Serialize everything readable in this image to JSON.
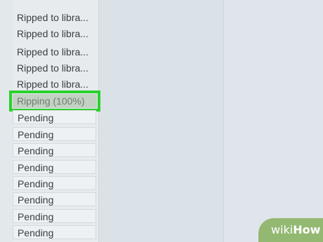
{
  "rip_status": {
    "items": [
      {
        "label": "Ripped to libra...",
        "state": "ripped"
      },
      {
        "label": "Ripped to libra...",
        "state": "ripped"
      },
      {
        "label": "Ripped to libra...",
        "state": "ripped"
      },
      {
        "label": "Ripped to libra...",
        "state": "ripped"
      },
      {
        "label": "Ripped to libra...",
        "state": "ripped"
      },
      {
        "label": "Ripping (100%)",
        "state": "ripping",
        "progress": 1.0
      },
      {
        "label": "Pending",
        "state": "pending"
      },
      {
        "label": "Pending",
        "state": "pending"
      },
      {
        "label": "Pending",
        "state": "pending"
      },
      {
        "label": "Pending",
        "state": "pending"
      },
      {
        "label": "Pending",
        "state": "pending"
      },
      {
        "label": "Pending",
        "state": "pending"
      },
      {
        "label": "Pending",
        "state": "pending"
      },
      {
        "label": "Pending",
        "state": "pending"
      }
    ]
  },
  "highlight": {
    "color": "#2bd12b"
  },
  "watermark": {
    "wiki": "wiki",
    "how": "How",
    "color": "#93b872"
  }
}
